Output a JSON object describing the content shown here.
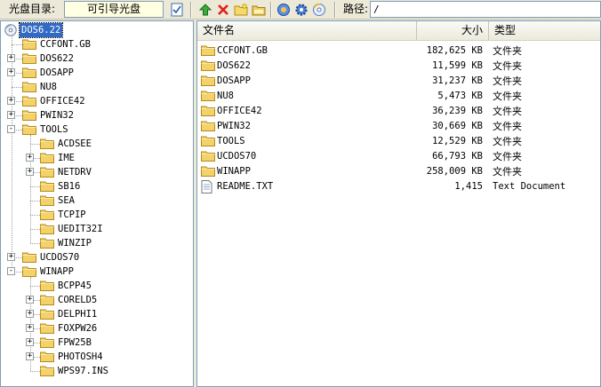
{
  "toolbar": {
    "disc_dir_label": "光盘目录:",
    "disc_value": "可引导光盘",
    "path_label": "路径:",
    "path_value": "/",
    "buttons": [
      {
        "icon": "note-check-icon"
      },
      {
        "icon": "up-arrow-icon"
      },
      {
        "icon": "delete-x-icon"
      },
      {
        "icon": "new-folder-icon"
      },
      {
        "icon": "folder-open-icon"
      },
      {
        "icon": "properties-icon"
      },
      {
        "icon": "gear-icon"
      },
      {
        "icon": "disc-icon"
      }
    ]
  },
  "tree": {
    "root": "DOS6.22",
    "items": [
      {
        "label": "CCFONT.GB",
        "level": 1,
        "expander": ""
      },
      {
        "label": "DOS622",
        "level": 1,
        "expander": "+"
      },
      {
        "label": "DOSAPP",
        "level": 1,
        "expander": "+"
      },
      {
        "label": "NU8",
        "level": 1,
        "expander": ""
      },
      {
        "label": "OFFICE42",
        "level": 1,
        "expander": "+"
      },
      {
        "label": "PWIN32",
        "level": 1,
        "expander": "+"
      },
      {
        "label": "TOOLS",
        "level": 1,
        "expander": "-"
      },
      {
        "label": "ACDSEE",
        "level": 2,
        "expander": ""
      },
      {
        "label": "IME",
        "level": 2,
        "expander": "+"
      },
      {
        "label": "NETDRV",
        "level": 2,
        "expander": "+"
      },
      {
        "label": "SB16",
        "level": 2,
        "expander": ""
      },
      {
        "label": "SEA",
        "level": 2,
        "expander": ""
      },
      {
        "label": "TCPIP",
        "level": 2,
        "expander": ""
      },
      {
        "label": "UEDIT32I",
        "level": 2,
        "expander": ""
      },
      {
        "label": "WINZIP",
        "level": 2,
        "expander": ""
      },
      {
        "label": "UCDOS70",
        "level": 1,
        "expander": "+"
      },
      {
        "label": "WINAPP",
        "level": 1,
        "expander": "-"
      },
      {
        "label": "BCPP45",
        "level": 2,
        "expander": ""
      },
      {
        "label": "CORELD5",
        "level": 2,
        "expander": "+"
      },
      {
        "label": "DELPHI1",
        "level": 2,
        "expander": "+"
      },
      {
        "label": "FOXPW26",
        "level": 2,
        "expander": "+"
      },
      {
        "label": "FPW25B",
        "level": 2,
        "expander": "+"
      },
      {
        "label": "PHOTOSH4",
        "level": 2,
        "expander": "+"
      },
      {
        "label": "WPS97.INS",
        "level": 2,
        "expander": ""
      }
    ]
  },
  "list": {
    "columns": {
      "name": "文件名",
      "size": "大小",
      "type": "类型"
    },
    "rows": [
      {
        "name": "CCFONT.GB",
        "size": "182,625 KB",
        "type": "文件夹",
        "icon": "folder-icon"
      },
      {
        "name": "DOS622",
        "size": "11,599 KB",
        "type": "文件夹",
        "icon": "folder-icon"
      },
      {
        "name": "DOSAPP",
        "size": "31,237 KB",
        "type": "文件夹",
        "icon": "folder-icon"
      },
      {
        "name": "NU8",
        "size": "5,473 KB",
        "type": "文件夹",
        "icon": "folder-icon"
      },
      {
        "name": "OFFICE42",
        "size": "36,239 KB",
        "type": "文件夹",
        "icon": "folder-icon"
      },
      {
        "name": "PWIN32",
        "size": "30,669 KB",
        "type": "文件夹",
        "icon": "folder-icon"
      },
      {
        "name": "TOOLS",
        "size": "12,529 KB",
        "type": "文件夹",
        "icon": "folder-icon"
      },
      {
        "name": "UCDOS70",
        "size": "66,793 KB",
        "type": "文件夹",
        "icon": "folder-icon"
      },
      {
        "name": "WINAPP",
        "size": "258,009 KB",
        "type": "文件夹",
        "icon": "folder-icon"
      },
      {
        "name": "README.TXT",
        "size": "1,415",
        "type": "Text Document",
        "icon": "text-file-icon"
      }
    ]
  },
  "colors": {
    "selection": "#316ac5",
    "folder": "#f3d26a",
    "border": "#7f9db9"
  }
}
